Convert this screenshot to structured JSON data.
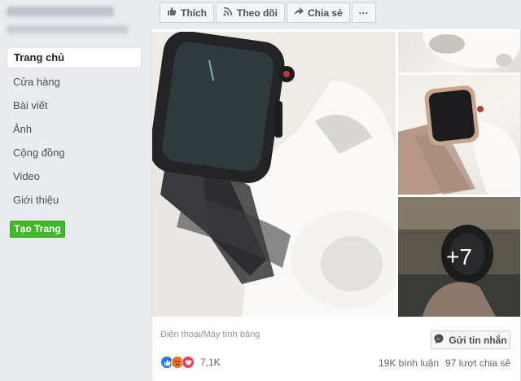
{
  "sidebar": {
    "items": [
      {
        "label": "Trang chủ",
        "active": true
      },
      {
        "label": "Cửa hàng"
      },
      {
        "label": "Bài viết"
      },
      {
        "label": "Ảnh"
      },
      {
        "label": "Cộng đồng"
      },
      {
        "label": "Video"
      },
      {
        "label": "Giới thiệu"
      }
    ],
    "create_button": "Tạo Trang"
  },
  "actions": {
    "like": "Thích",
    "follow": "Theo dõi",
    "share": "Chia sẻ",
    "more": "···"
  },
  "post": {
    "more_photos": "+7",
    "category": "Điện thoại/Máy tính bảng",
    "message_button": "Gửi tin nhắn",
    "reaction_count": "7,1K",
    "comments": "19K bình luận",
    "shares": "97 lượt chia sẻ"
  },
  "icons": {
    "like": "thumbs-up-icon",
    "follow": "rss-icon",
    "share": "share-arrow-icon",
    "message": "messenger-icon"
  },
  "colors": {
    "accent_green": "#42b72a",
    "like_blue": "#1877f2",
    "angry_orange": "#e9710f",
    "love_red": "#f33e58"
  }
}
